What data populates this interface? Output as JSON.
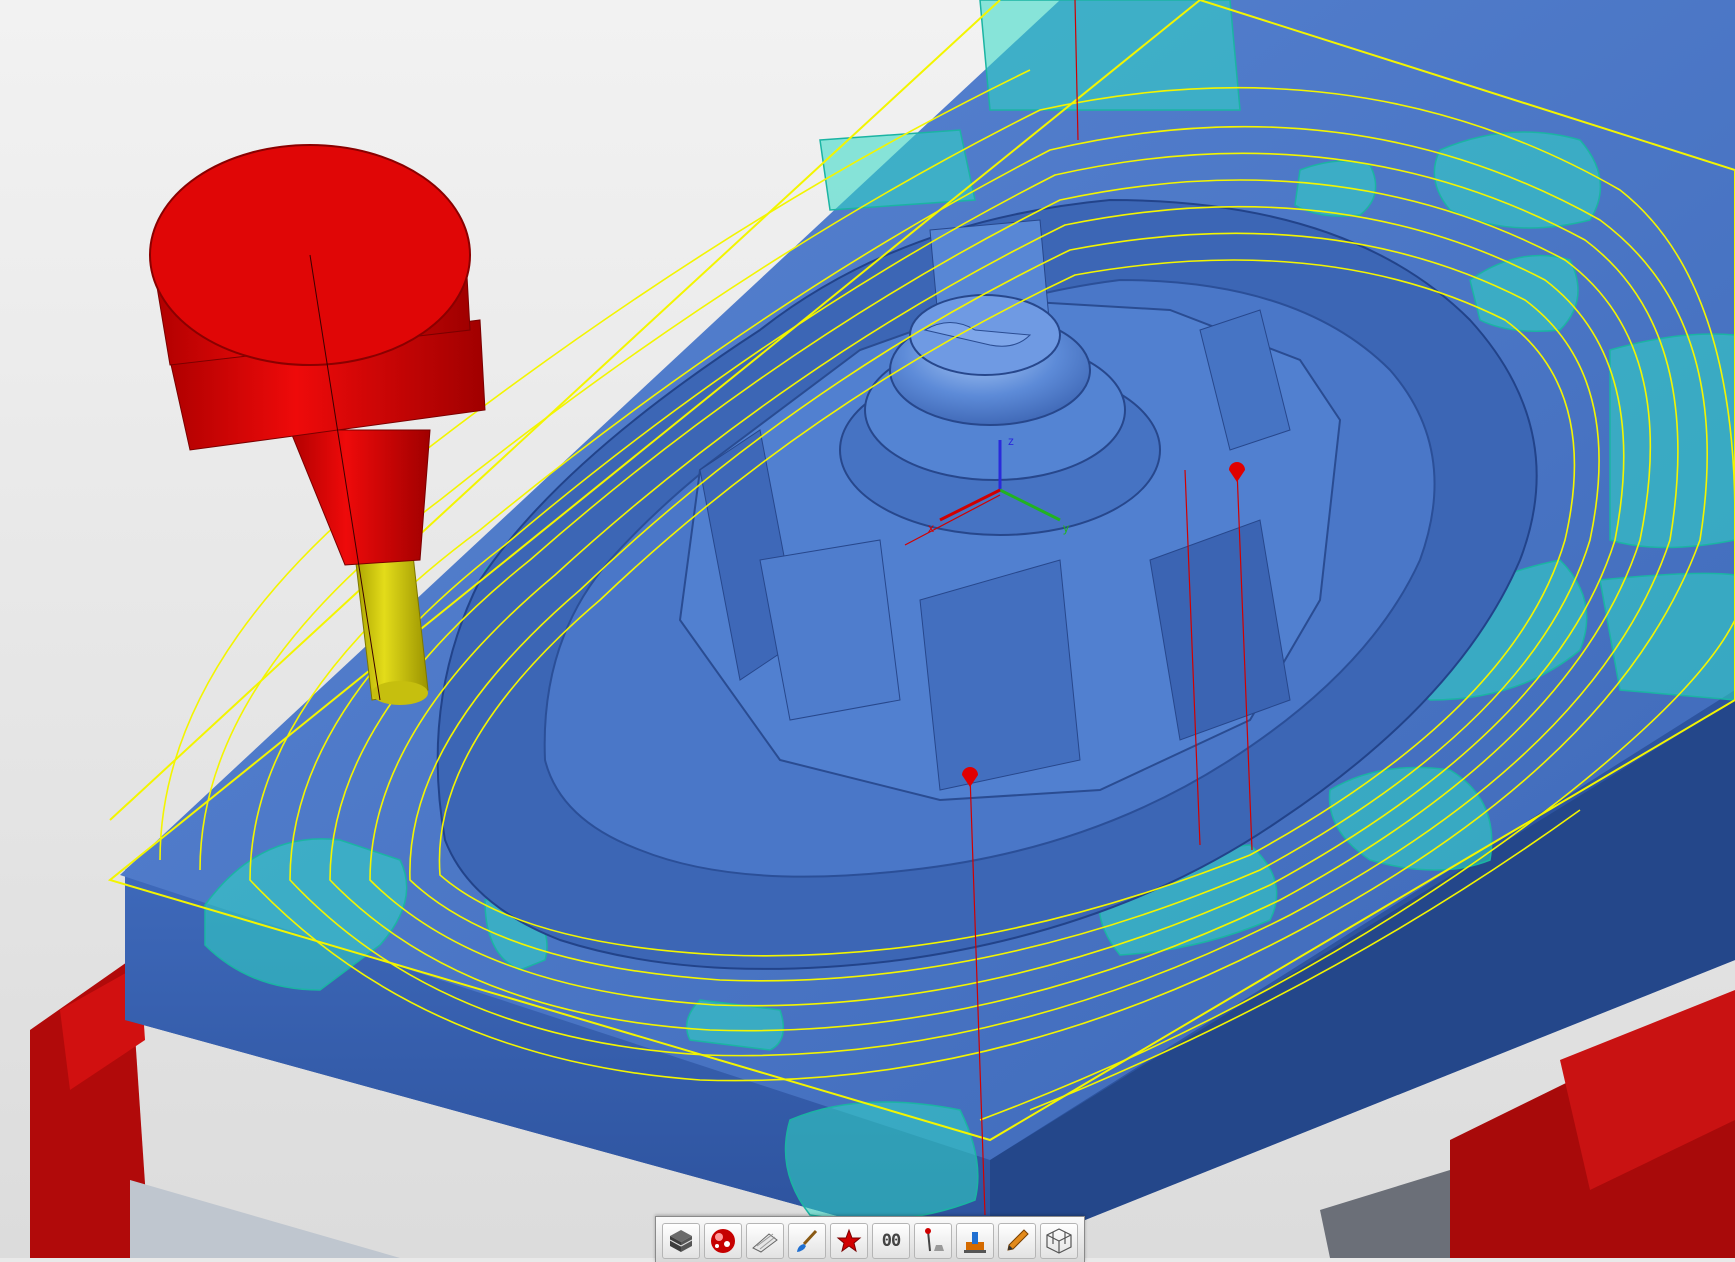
{
  "viewport": {
    "background": "#e9e9e9",
    "part_color": "#4c77c4",
    "toolpath_color": "#f3f500",
    "clamp_color": "#c00a0a",
    "highlight_color": "#30d8c4",
    "tool_holder_color": "#d90000",
    "tool_shank_color": "#d6cf00"
  },
  "axis_triad": {
    "x_label": "x",
    "y_label": "y",
    "z_label": "z"
  },
  "toolbar": {
    "items": [
      {
        "name": "stock-display",
        "icon": "layered-cube-icon"
      },
      {
        "name": "machine-sim",
        "icon": "red-ball-icon"
      },
      {
        "name": "sheet-view",
        "icon": "sheet-pencil-icon"
      },
      {
        "name": "brush",
        "icon": "paint-brush-icon"
      },
      {
        "name": "highlight",
        "icon": "star-icon"
      },
      {
        "name": "numbering",
        "icon": "number-icon",
        "label": "00"
      },
      {
        "name": "probe",
        "icon": "probe-icon"
      },
      {
        "name": "fixture",
        "icon": "fixture-icon"
      },
      {
        "name": "pencil",
        "icon": "pencil-icon"
      },
      {
        "name": "wireframe",
        "icon": "wireframe-cube-icon"
      }
    ]
  }
}
